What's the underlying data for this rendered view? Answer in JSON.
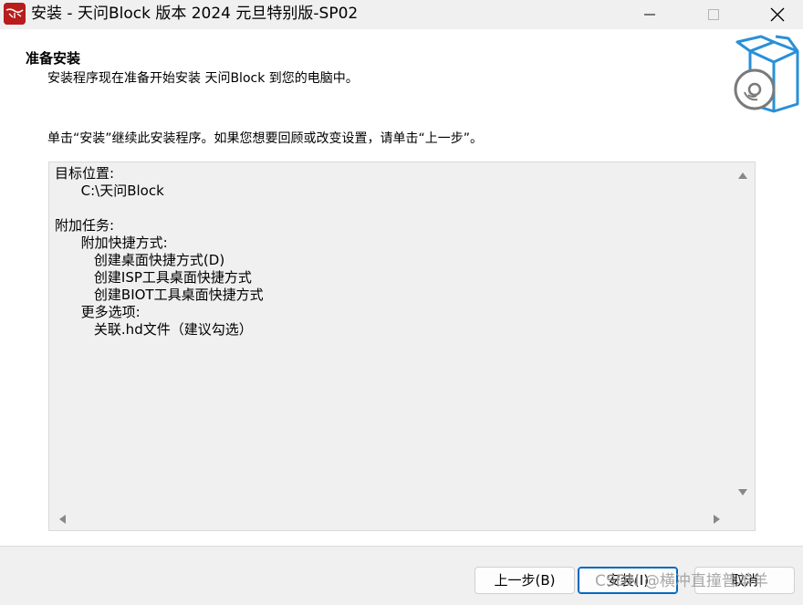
{
  "window": {
    "title": "安装 - 天问Block 版本 2024 元旦特别版-SP02",
    "icon": "app-logo-icon",
    "controls": [
      "minimize-icon",
      "maximize-icon",
      "close-icon"
    ]
  },
  "header": {
    "heading": "准备安装",
    "subheading": "安装程序现在准备开始安装 天问Block 到您的电脑中。"
  },
  "instructions": "单击“安装”继续此安装程序。如果您想要回顾或改变设置，请单击“上一步”。",
  "summary": {
    "lines": [
      "目标位置:",
      "      C:\\天问Block",
      "",
      "附加任务:",
      "      附加快捷方式:",
      "         创建桌面快捷方式(D)",
      "         创建ISP工具桌面快捷方式",
      "         创建BIOT工具桌面快捷方式",
      "      更多选项:",
      "         关联.hd文件（建议勾选）"
    ]
  },
  "buttons": {
    "back": "上一步(B)",
    "install": "安装(I)",
    "cancel": "取消"
  },
  "watermark": "CSDN @横冲直撞普羊羊",
  "colors": {
    "accent": "#0067c0",
    "app_icon_bg": "#b81c1c",
    "graphic_blue": "#2a8fd8"
  }
}
